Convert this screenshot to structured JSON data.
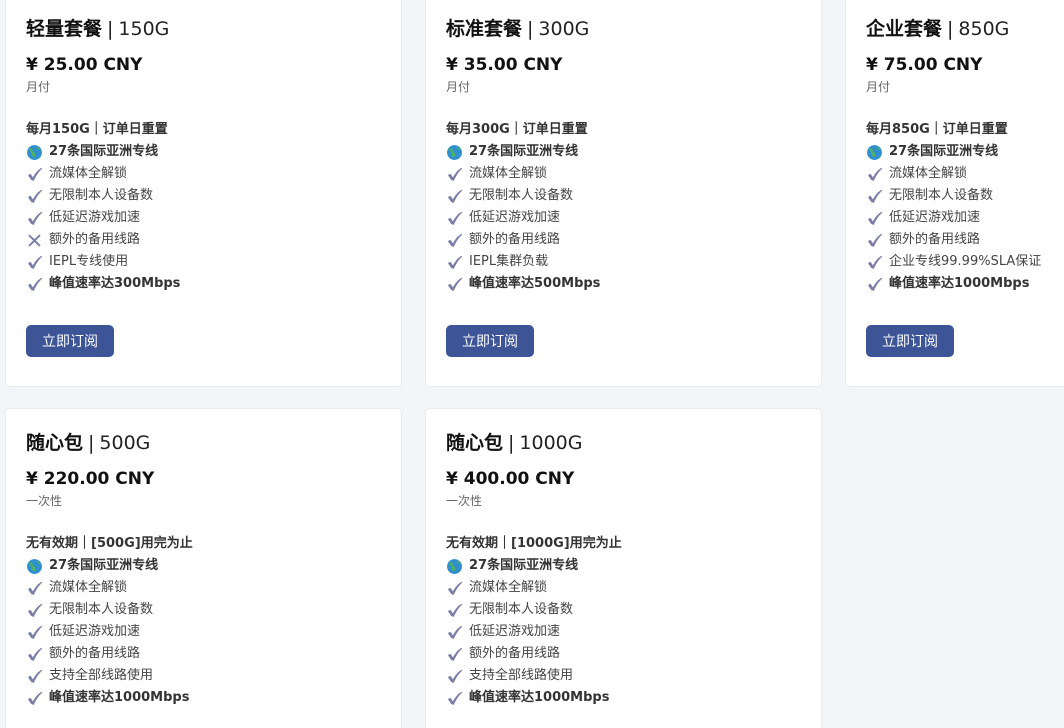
{
  "icons": {
    "globe": "globe-icon",
    "check": "check-icon",
    "cross": "cross-icon"
  },
  "plans": [
    {
      "name": "轻量套餐",
      "separator": "|",
      "size": "150G",
      "price": "¥ 25.00 CNY",
      "period": "月付",
      "headline": "每月150G｜订单日重置",
      "features": [
        {
          "icon": "globe",
          "text": "27条国际亚洲专线",
          "bold": true
        },
        {
          "icon": "check",
          "text": "流媒体全解锁",
          "bold": false
        },
        {
          "icon": "check",
          "text": "无限制本人设备数",
          "bold": false
        },
        {
          "icon": "check",
          "text": "低延迟游戏加速",
          "bold": false
        },
        {
          "icon": "cross",
          "text": "额外的备用线路",
          "bold": false
        },
        {
          "icon": "check",
          "text": "IEPL专线使用",
          "bold": false
        },
        {
          "icon": "check",
          "text": "峰值速率达300Mbps",
          "bold": true
        }
      ],
      "button": "立即订阅"
    },
    {
      "name": "标准套餐",
      "separator": "|",
      "size": "300G",
      "price": "¥ 35.00 CNY",
      "period": "月付",
      "headline": "每月300G｜订单日重置",
      "features": [
        {
          "icon": "globe",
          "text": "27条国际亚洲专线",
          "bold": true
        },
        {
          "icon": "check",
          "text": "流媒体全解锁",
          "bold": false
        },
        {
          "icon": "check",
          "text": "无限制本人设备数",
          "bold": false
        },
        {
          "icon": "check",
          "text": "低延迟游戏加速",
          "bold": false
        },
        {
          "icon": "check",
          "text": "额外的备用线路",
          "bold": false
        },
        {
          "icon": "check",
          "text": "IEPL集群负载",
          "bold": false
        },
        {
          "icon": "check",
          "text": "峰值速率达500Mbps",
          "bold": true
        }
      ],
      "button": "立即订阅"
    },
    {
      "name": "企业套餐",
      "separator": "|",
      "size": "850G",
      "price": "¥ 75.00 CNY",
      "period": "月付",
      "headline": "每月850G｜订单日重置",
      "features": [
        {
          "icon": "globe",
          "text": "27条国际亚洲专线",
          "bold": true
        },
        {
          "icon": "check",
          "text": "流媒体全解锁",
          "bold": false
        },
        {
          "icon": "check",
          "text": "无限制本人设备数",
          "bold": false
        },
        {
          "icon": "check",
          "text": "低延迟游戏加速",
          "bold": false
        },
        {
          "icon": "check",
          "text": "额外的备用线路",
          "bold": false
        },
        {
          "icon": "check",
          "text": "企业专线99.99%SLA保证",
          "bold": false
        },
        {
          "icon": "check",
          "text": "峰值速率达1000Mbps",
          "bold": true
        }
      ],
      "button": "立即订阅"
    },
    {
      "name": "随心包",
      "separator": "|",
      "size": "500G",
      "price": "¥ 220.00 CNY",
      "period": "一次性",
      "headline": "无有效期｜[500G]用完为止",
      "features": [
        {
          "icon": "globe",
          "text": "27条国际亚洲专线",
          "bold": true
        },
        {
          "icon": "check",
          "text": "流媒体全解锁",
          "bold": false
        },
        {
          "icon": "check",
          "text": "无限制本人设备数",
          "bold": false
        },
        {
          "icon": "check",
          "text": "低延迟游戏加速",
          "bold": false
        },
        {
          "icon": "check",
          "text": "额外的备用线路",
          "bold": false
        },
        {
          "icon": "check",
          "text": "支持全部线路使用",
          "bold": false
        },
        {
          "icon": "check",
          "text": "峰值速率达1000Mbps",
          "bold": true
        }
      ],
      "button": "立即订阅"
    },
    {
      "name": "随心包",
      "separator": "|",
      "size": "1000G",
      "price": "¥ 400.00 CNY",
      "period": "一次性",
      "headline": "无有效期｜[1000G]用完为止",
      "features": [
        {
          "icon": "globe",
          "text": "27条国际亚洲专线",
          "bold": true
        },
        {
          "icon": "check",
          "text": "流媒体全解锁",
          "bold": false
        },
        {
          "icon": "check",
          "text": "无限制本人设备数",
          "bold": false
        },
        {
          "icon": "check",
          "text": "低延迟游戏加速",
          "bold": false
        },
        {
          "icon": "check",
          "text": "额外的备用线路",
          "bold": false
        },
        {
          "icon": "check",
          "text": "支持全部线路使用",
          "bold": false
        },
        {
          "icon": "check",
          "text": "峰值速率达1000Mbps",
          "bold": true
        }
      ],
      "button": "立即订阅"
    }
  ],
  "colors": {
    "accent": "#3d5597",
    "check": "#7c7ea8",
    "cross": "#7c7ea8",
    "globe_ocean": "#2f8fd0",
    "globe_land": "#4caf6a"
  }
}
